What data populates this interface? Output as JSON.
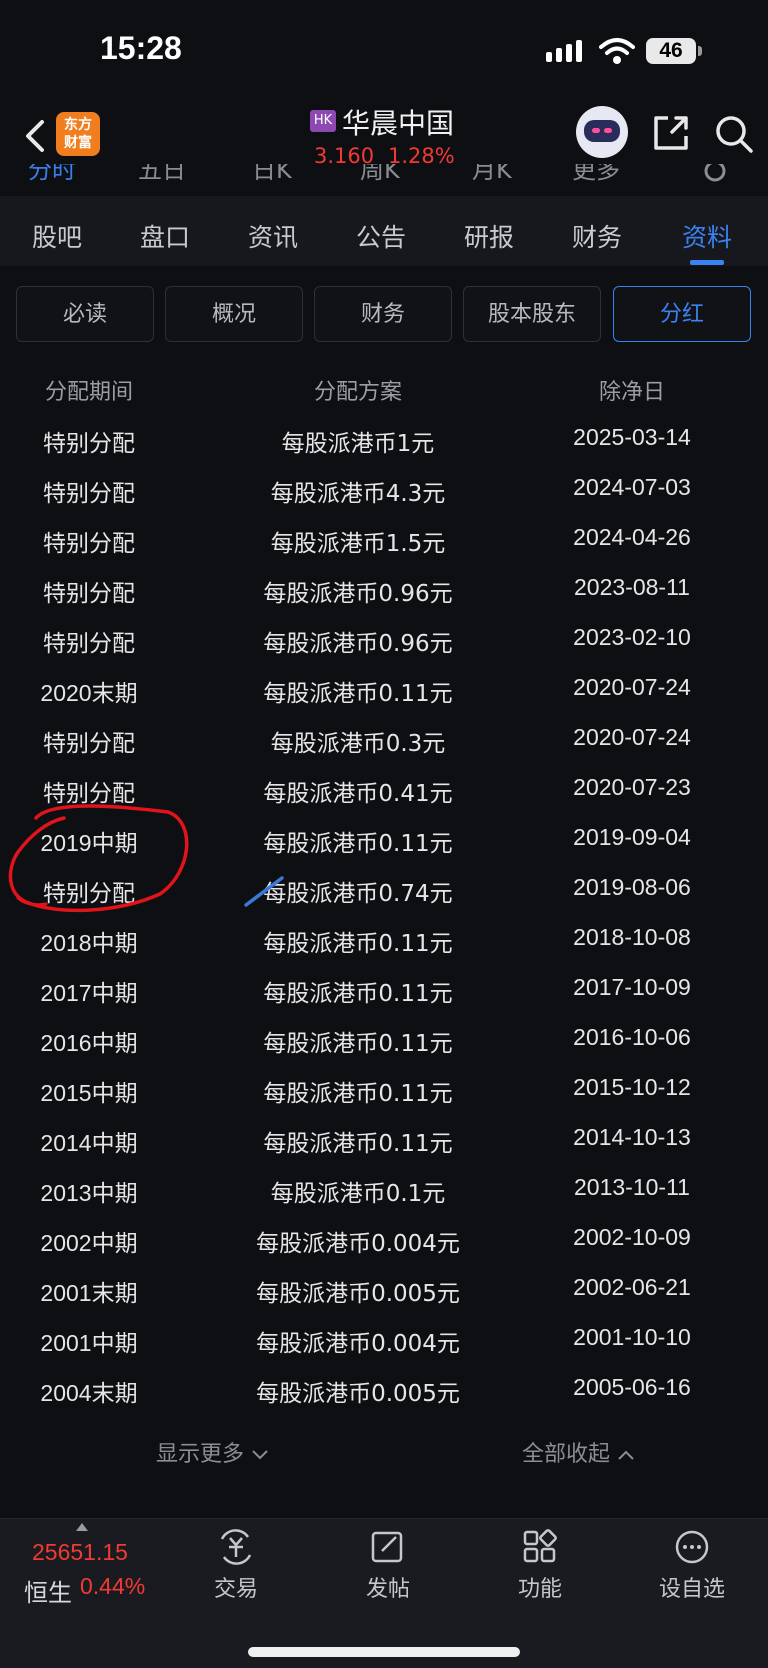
{
  "status_bar": {
    "time": "15:28",
    "battery": "46"
  },
  "header": {
    "logo_line1": "东方",
    "logo_line2": "财富",
    "market_badge": "HK",
    "stock_name": "华晨中国",
    "price": "3.160",
    "change_pct": "1.28%"
  },
  "chart_tabs": [
    "分时",
    "五日",
    "日K",
    "周K",
    "月K",
    "更多"
  ],
  "section_tabs": [
    "股吧",
    "盘口",
    "资讯",
    "公告",
    "研报",
    "财务",
    "资料"
  ],
  "section_active": "资料",
  "sub_tabs": [
    "必读",
    "概况",
    "财务",
    "股本股东",
    "分红"
  ],
  "sub_active": "分红",
  "table": {
    "headers": [
      "分配期间",
      "分配方案",
      "除净日"
    ],
    "rows": [
      [
        "特别分配",
        "每股派港币1元",
        "2025-03-14"
      ],
      [
        "特别分配",
        "每股派港币4.3元",
        "2024-07-03"
      ],
      [
        "特别分配",
        "每股派港币1.5元",
        "2024-04-26"
      ],
      [
        "特别分配",
        "每股派港币0.96元",
        "2023-08-11"
      ],
      [
        "特别分配",
        "每股派港币0.96元",
        "2023-02-10"
      ],
      [
        "2020末期",
        "每股派港币0.11元",
        "2020-07-24"
      ],
      [
        "特别分配",
        "每股派港币0.3元",
        "2020-07-24"
      ],
      [
        "特别分配",
        "每股派港币0.41元",
        "2020-07-23"
      ],
      [
        "2019中期",
        "每股派港币0.11元",
        "2019-09-04"
      ],
      [
        "特别分配",
        "每股派港币0.74元",
        "2019-08-06"
      ],
      [
        "2018中期",
        "每股派港币0.11元",
        "2018-10-08"
      ],
      [
        "2017中期",
        "每股派港币0.11元",
        "2017-10-09"
      ],
      [
        "2016中期",
        "每股派港币0.11元",
        "2016-10-06"
      ],
      [
        "2015中期",
        "每股派港币0.11元",
        "2015-10-12"
      ],
      [
        "2014中期",
        "每股派港币0.11元",
        "2014-10-13"
      ],
      [
        "2013中期",
        "每股派港币0.1元",
        "2013-10-11"
      ],
      [
        "2002中期",
        "每股派港币0.004元",
        "2002-10-09"
      ],
      [
        "2001末期",
        "每股派港币0.005元",
        "2002-06-21"
      ],
      [
        "2001中期",
        "每股派港币0.004元",
        "2001-10-10"
      ],
      [
        "2004末期",
        "每股派港币0.005元",
        "2005-06-16"
      ]
    ]
  },
  "footer_links": {
    "show_more": "显示更多",
    "collapse_all": "全部收起"
  },
  "bottom_bar": {
    "index_value": "25651.15",
    "index_name": "恒生",
    "index_change": "0.44%",
    "nav": [
      "交易",
      "发帖",
      "功能",
      "设自选"
    ]
  },
  "colors": {
    "accent": "#3b82f0",
    "up": "#f23a35",
    "background": "#0e0f12",
    "annotation": "#e0141a"
  }
}
